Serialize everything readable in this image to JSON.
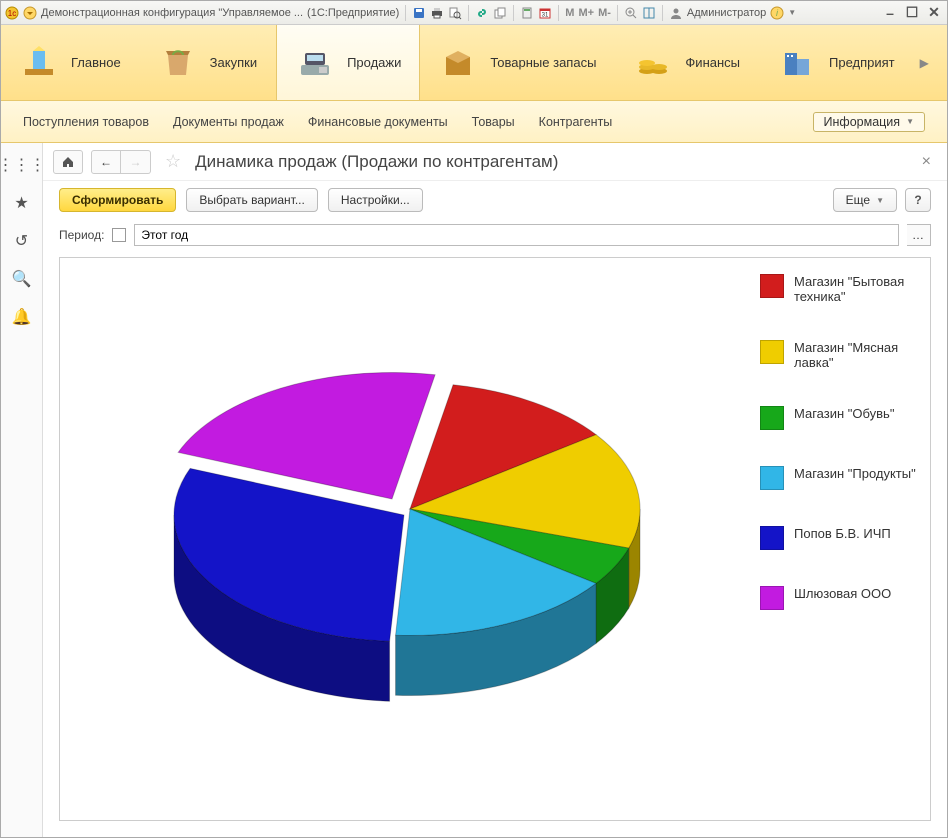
{
  "titlebar": {
    "app_title": "Демонстрационная конфигурация \"Управляемое ...",
    "product": "(1С:Предприятие)",
    "calc": {
      "m": "M",
      "mplus": "M+",
      "mminus": "M-"
    },
    "user_label": "Администратор"
  },
  "sections": [
    {
      "label": "Главное"
    },
    {
      "label": "Закупки"
    },
    {
      "label": "Продажи",
      "active": true
    },
    {
      "label": "Товарные запасы"
    },
    {
      "label": "Финансы"
    },
    {
      "label": "Предприят"
    }
  ],
  "subnav": {
    "items": [
      "Поступления товаров",
      "Документы продаж",
      "Финансовые документы",
      "Товары",
      "Контрагенты"
    ],
    "info_label": "Информация"
  },
  "page": {
    "title": "Динамика продаж (Продажи по контрагентам)"
  },
  "toolbar": {
    "primary": "Сформировать",
    "variant": "Выбрать вариант...",
    "settings": "Настройки...",
    "more": "Еще"
  },
  "period": {
    "label": "Период:",
    "value": "Этот год"
  },
  "chart_data": {
    "type": "pie",
    "title": "Динамика продаж (Продажи по контрагентам)",
    "series": [
      {
        "name": "Магазин \"Бытовая техника\"",
        "value": 12,
        "color": "#d21d1d"
      },
      {
        "name": "Магазин \"Мясная лавка\"",
        "value": 15,
        "color": "#efcd00"
      },
      {
        "name": "Магазин \"Обувь\"",
        "value": 5,
        "color": "#17a81a"
      },
      {
        "name": "Магазин \"Продукты\"",
        "value": 16,
        "color": "#31b6e7"
      },
      {
        "name": "Попов Б.В. ИЧП",
        "value": 30,
        "color": "#1414c8"
      },
      {
        "name": "Шлюзовая ООО",
        "value": 22,
        "color": "#c21be0"
      }
    ]
  }
}
